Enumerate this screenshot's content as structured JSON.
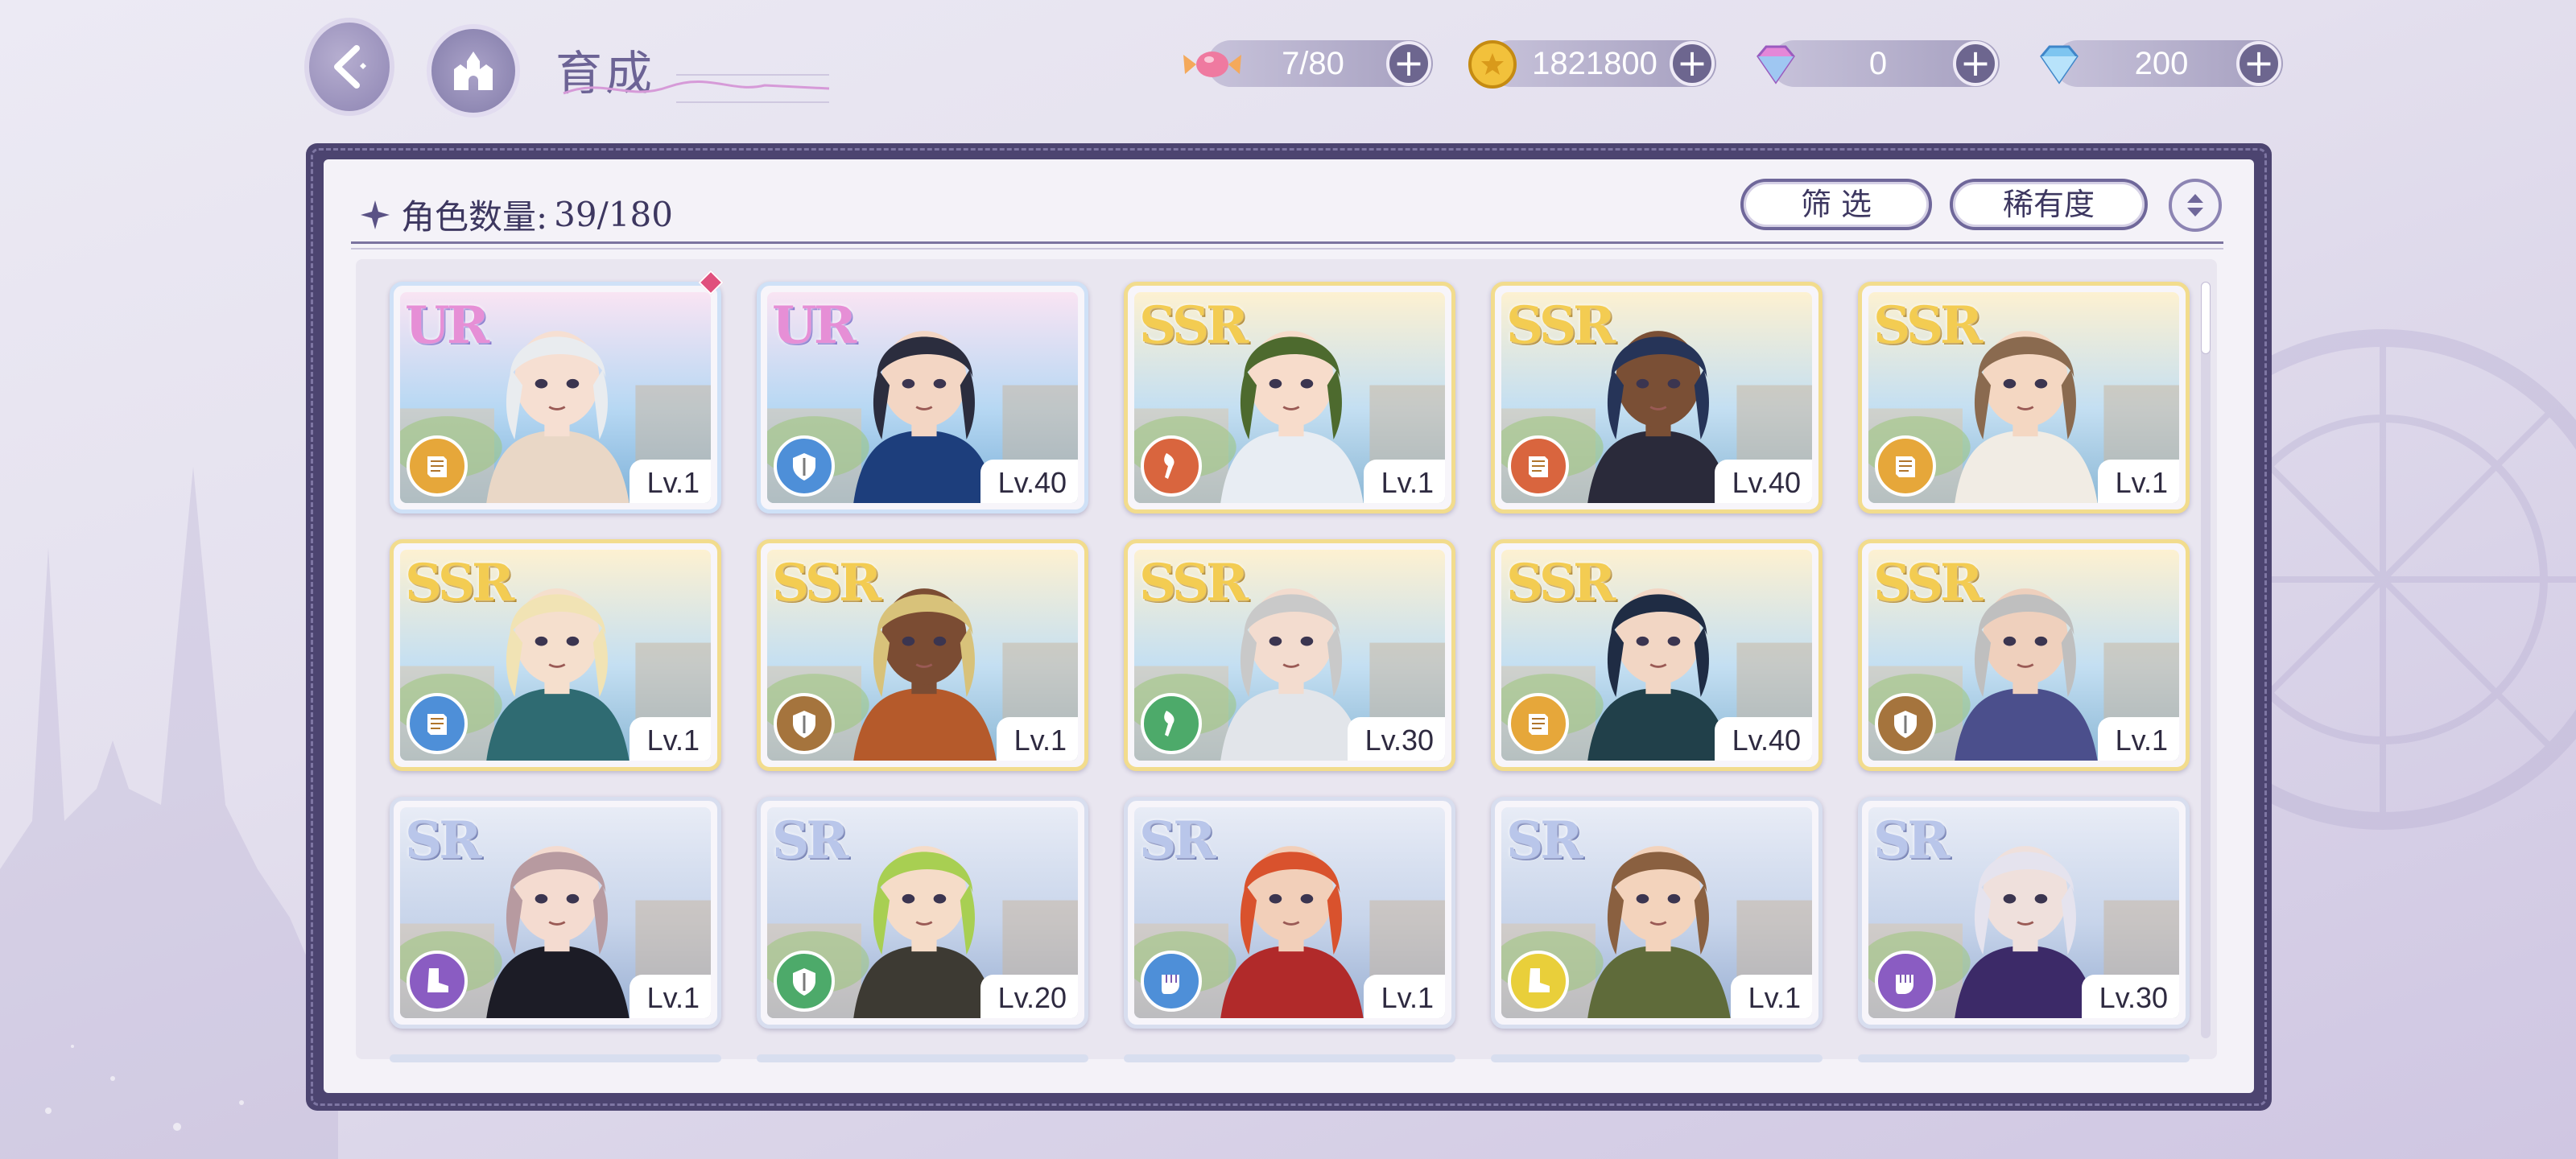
{
  "header": {
    "title": "育成",
    "resources": [
      {
        "icon": "candy-icon",
        "value": "7/80"
      },
      {
        "icon": "coin-icon",
        "value": "1821800"
      },
      {
        "icon": "pink-gem-icon",
        "value": "0"
      },
      {
        "icon": "blue-diamond-icon",
        "value": "200"
      }
    ]
  },
  "panel": {
    "count_label": "角色数量:",
    "count_value": "39/180",
    "filter_label": "筛 选",
    "sort_label": "稀有度"
  },
  "colors": {
    "role_orange": "#e6a73a",
    "role_blue": "#4e8fd8",
    "role_red": "#d9653e",
    "role_brown": "#a5743d",
    "role_green": "#4daa6a",
    "role_purple": "#8a5cc2",
    "role_yellow": "#e9cf3a"
  },
  "cards": [
    {
      "rarity": "UR",
      "level": "Lv.1",
      "role": "orange",
      "role_icon": "book-icon",
      "new": true
    },
    {
      "rarity": "UR",
      "level": "Lv.40",
      "role": "blue",
      "role_icon": "shield-icon"
    },
    {
      "rarity": "SSR",
      "level": "Lv.1",
      "role": "red",
      "role_icon": "torch-icon"
    },
    {
      "rarity": "SSR",
      "level": "Lv.40",
      "role": "red",
      "role_icon": "book-icon"
    },
    {
      "rarity": "SSR",
      "level": "Lv.1",
      "role": "orange",
      "role_icon": "book-icon"
    },
    {
      "rarity": "SSR",
      "level": "Lv.1",
      "role": "blue",
      "role_icon": "book-icon"
    },
    {
      "rarity": "SSR",
      "level": "Lv.1",
      "role": "brown",
      "role_icon": "shield-icon"
    },
    {
      "rarity": "SSR",
      "level": "Lv.30",
      "role": "green",
      "role_icon": "torch-icon"
    },
    {
      "rarity": "SSR",
      "level": "Lv.40",
      "role": "orange",
      "role_icon": "book-icon"
    },
    {
      "rarity": "SSR",
      "level": "Lv.1",
      "role": "brown",
      "role_icon": "shield-icon"
    },
    {
      "rarity": "SR",
      "level": "Lv.1",
      "role": "purple",
      "role_icon": "boot-icon"
    },
    {
      "rarity": "SR",
      "level": "Lv.20",
      "role": "green",
      "role_icon": "shield-icon"
    },
    {
      "rarity": "SR",
      "level": "Lv.1",
      "role": "blue",
      "role_icon": "fist-icon"
    },
    {
      "rarity": "SR",
      "level": "Lv.1",
      "role": "yellow",
      "role_icon": "boot-icon"
    },
    {
      "rarity": "SR",
      "level": "Lv.30",
      "role": "purple",
      "role_icon": "fist-icon"
    }
  ]
}
